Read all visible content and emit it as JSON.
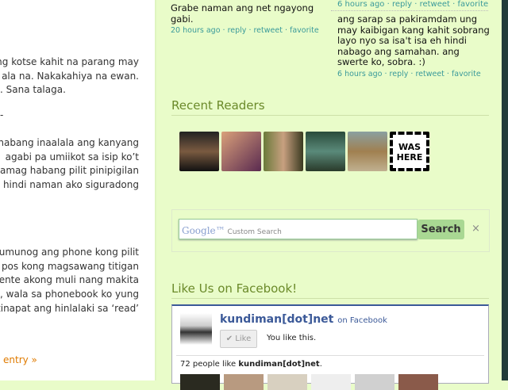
{
  "post": {
    "lines": [
      "ng kotse kahit na parang may",
      "ala na. Nakakahiya na ewan.",
      ". Sana talaga.",
      "-",
      "habang inaalala ang kanyang",
      "agabi pa umiikot sa isip ko’t",
      "amag habang pilit pinipigilan",
      "hindi naman ako siguradong",
      "tumunog ang phone kong pilit",
      "pos kong magsawang titigan",
      "yente akong muli nang makita",
      ", wala sa phonebook ko yung",
      "tinapat ang hinlalaki sa ‘read’"
    ],
    "more_link": "entry »"
  },
  "tweets": [
    {
      "text": "Grabe naman ang net ngayong gabi.",
      "time": "20 hours ago",
      "reply": "reply",
      "retweet": "retweet",
      "favorite": "favorite"
    },
    {
      "text": "ang sarap sa pakiramdam ung may kaibigan kang kahit sobrang layo nyo sa isa't isa eh hindi nabago ang samahan. ang swerte ko, sobra. :)",
      "time": "6 hours ago",
      "reply": "reply",
      "retweet": "retweet",
      "favorite": "favorite"
    }
  ],
  "tweet_top_meta": "6 hours ago · reply · retweet · favorite",
  "recent_readers": {
    "title": "Recent Readers",
    "badge": [
      "WAS",
      "HERE"
    ]
  },
  "search": {
    "placeholder_brand": "Google™",
    "placeholder": "Custom Search",
    "button": "Search",
    "clear": "×"
  },
  "facebook": {
    "title": "Like Us on Facebook!",
    "page_name": "kundiman[dot]net",
    "on_facebook": "on Facebook",
    "like_button": "✔ Like",
    "you_like": "You like this.",
    "count_prefix": "72 people like ",
    "count_name": "kundiman[dot]net",
    "count_suffix": "."
  },
  "colors": {
    "sidebar_bg": "#e9fcc9",
    "heading": "#6b8a2a",
    "link": "#3a9a9a",
    "more_link": "#e07b00",
    "facebook_blue": "#3b5998"
  }
}
